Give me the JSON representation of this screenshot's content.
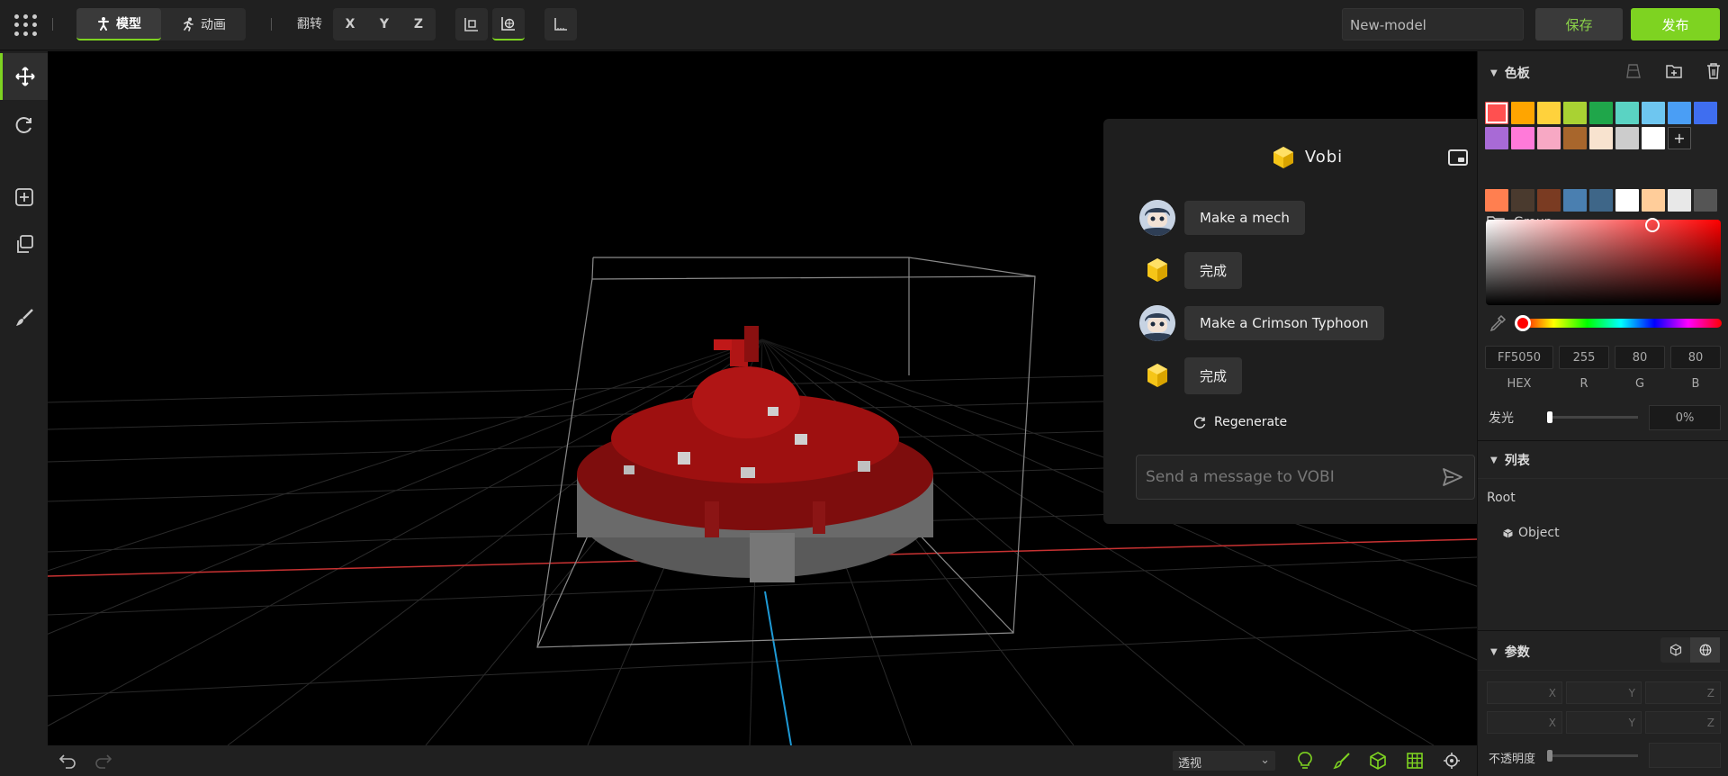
{
  "toolbar": {
    "mode_model": "模型",
    "mode_animation": "动画",
    "flip_label": "翻转",
    "axis_x": "X",
    "axis_y": "Y",
    "axis_z": "Z",
    "model_name": "New-model",
    "save_label": "保存",
    "publish_label": "发布"
  },
  "chat": {
    "title": "Vobi",
    "messages": [
      {
        "role": "user",
        "text": "Make a mech"
      },
      {
        "role": "bot",
        "text": "完成"
      },
      {
        "role": "user",
        "text": "Make a Crimson Typhoon"
      },
      {
        "role": "bot",
        "text": "完成"
      }
    ],
    "regenerate_label": "Regenerate",
    "input_placeholder": "Send a message to VOBI"
  },
  "palette": {
    "title": "色板",
    "swatches": [
      "#ff5050",
      "#ffa500",
      "#ffd23c",
      "#a9d233",
      "#1fa64a",
      "#5ad3c3",
      "#6ec6f0",
      "#4a9ef5",
      "#3f6ef0",
      "#a86ad6",
      "#ff7ad9",
      "#f7a8c4",
      "#a8662c",
      "#f8e3cf",
      "#cccccc",
      "#ffffff"
    ],
    "group_label": "Group",
    "group_swatches": [
      "#ff7f50",
      "#4a3a2e",
      "#7a3b22",
      "#4a7fb0",
      "#3e6688",
      "#ffffff",
      "#ffcd9a",
      "#e8e8e8",
      "#555555"
    ],
    "hex": "FF5050",
    "r": "255",
    "g": "80",
    "b": "80",
    "hex_label": "HEX",
    "r_label": "R",
    "g_label": "G",
    "b_label": "B",
    "glow_label": "发光",
    "glow_value": "0%",
    "selected_color": "#ff5050"
  },
  "list": {
    "title": "列表",
    "root": "Root",
    "object": "Object"
  },
  "params": {
    "title": "参数",
    "x": "X",
    "y": "Y",
    "z": "Z",
    "opacity_label": "不透明度"
  },
  "bottom": {
    "view_mode": "透视"
  },
  "colors": {
    "accent": "#7ed321"
  }
}
